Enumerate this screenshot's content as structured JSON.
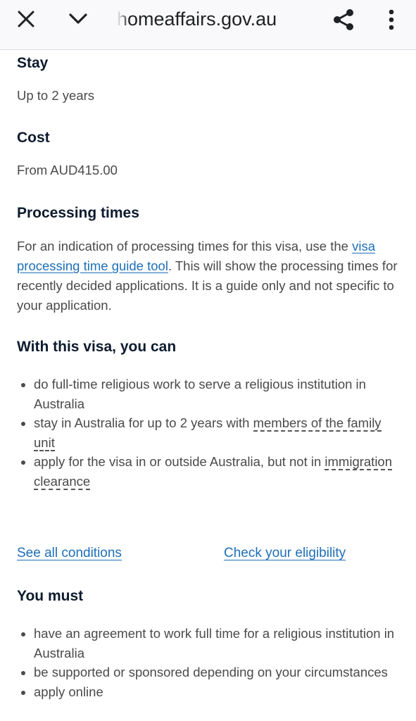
{
  "browser": {
    "url_text": "homeaffairs.gov.au",
    "close_icon": "close-icon",
    "chevron_icon": "chevron-down-icon",
    "share_icon": "share-icon",
    "more_icon": "more-vertical-icon"
  },
  "stay": {
    "heading": "Stay",
    "text": "Up to 2 years"
  },
  "cost": {
    "heading": "Cost",
    "text": "From AUD415.00"
  },
  "processing": {
    "heading": "Processing times",
    "text_before": "For an indication of processing times for this visa, use the ",
    "link": "visa processing time guide tool",
    "text_after": ". This will show the processing times for recently decided applications. It is a guide only and not specific to your application."
  },
  "with_visa": {
    "heading": "With this visa, you can",
    "items": [
      {
        "text": "do full-time religious work to serve a religious institution in Australia"
      },
      {
        "text": "stay in Australia for up to 2 years with ",
        "term": "members of the family unit"
      },
      {
        "text": "apply for the visa in or outside Australia, but not in ",
        "term": "immigration clearance"
      }
    ]
  },
  "links": {
    "see_all_conditions": "See all conditions",
    "check_eligibility": "Check your eligibility"
  },
  "you_must": {
    "heading": "You must",
    "items": [
      "have an agreement to work full time for a religious institution in Australia",
      "be supported or sponsored depending on your circumstances",
      "apply online"
    ]
  },
  "colors": {
    "link": "#1d6fb8",
    "heading": "#0d1b2e",
    "body_text": "#4a4a4a",
    "toolbar_bg": "#f9f9fb"
  }
}
